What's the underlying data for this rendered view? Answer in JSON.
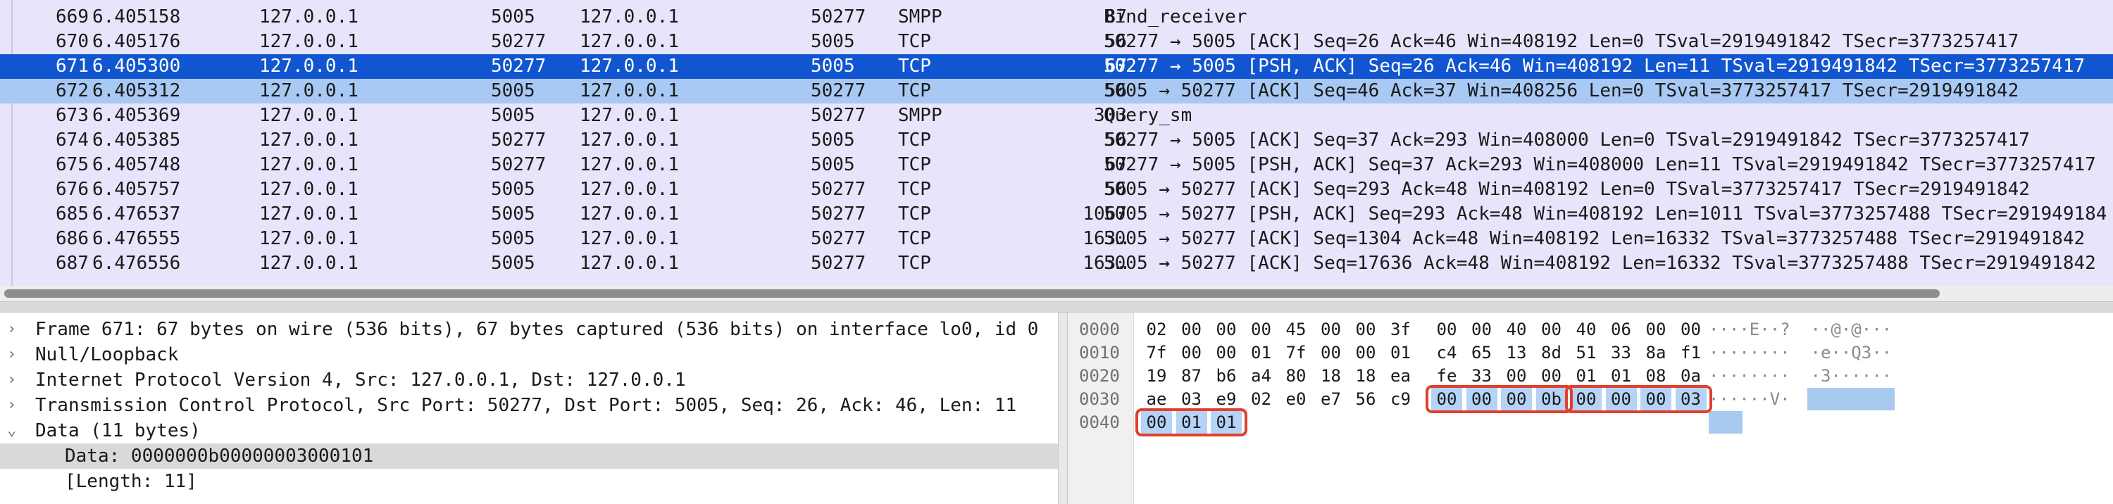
{
  "packet_list": {
    "rows": [
      {
        "no": "669",
        "time": "6.405158",
        "src": "127.0.0.1",
        "sport": "5005",
        "dst": "127.0.0.1",
        "dport": "50277",
        "proto": "SMPP",
        "len": "87",
        "info": "Bind_receiver",
        "state": "normal"
      },
      {
        "no": "670",
        "time": "6.405176",
        "src": "127.0.0.1",
        "sport": "50277",
        "dst": "127.0.0.1",
        "dport": "5005",
        "proto": "TCP",
        "len": "56",
        "info": "50277 → 5005 [ACK] Seq=26 Ack=46 Win=408192 Len=0 TSval=2919491842 TSecr=3773257417",
        "state": "normal"
      },
      {
        "no": "671",
        "time": "6.405300",
        "src": "127.0.0.1",
        "sport": "50277",
        "dst": "127.0.0.1",
        "dport": "5005",
        "proto": "TCP",
        "len": "67",
        "info": "50277 → 5005 [PSH, ACK] Seq=26 Ack=46 Win=408192 Len=11 TSval=2919491842 TSecr=3773257417",
        "state": "selected"
      },
      {
        "no": "672",
        "time": "6.405312",
        "src": "127.0.0.1",
        "sport": "5005",
        "dst": "127.0.0.1",
        "dport": "50277",
        "proto": "TCP",
        "len": "56",
        "info": "5005 → 50277 [ACK] Seq=46 Ack=37 Win=408256 Len=0 TSval=3773257417 TSecr=2919491842",
        "state": "related"
      },
      {
        "no": "673",
        "time": "6.405369",
        "src": "127.0.0.1",
        "sport": "5005",
        "dst": "127.0.0.1",
        "dport": "50277",
        "proto": "SMPP",
        "len": "303",
        "info": "Query_sm",
        "state": "normal"
      },
      {
        "no": "674",
        "time": "6.405385",
        "src": "127.0.0.1",
        "sport": "50277",
        "dst": "127.0.0.1",
        "dport": "5005",
        "proto": "TCP",
        "len": "56",
        "info": "50277 → 5005 [ACK] Seq=37 Ack=293 Win=408000 Len=0 TSval=2919491842 TSecr=3773257417",
        "state": "normal"
      },
      {
        "no": "675",
        "time": "6.405748",
        "src": "127.0.0.1",
        "sport": "50277",
        "dst": "127.0.0.1",
        "dport": "5005",
        "proto": "TCP",
        "len": "67",
        "info": "50277 → 5005 [PSH, ACK] Seq=37 Ack=293 Win=408000 Len=11 TSval=2919491842 TSecr=3773257417",
        "state": "normal"
      },
      {
        "no": "676",
        "time": "6.405757",
        "src": "127.0.0.1",
        "sport": "5005",
        "dst": "127.0.0.1",
        "dport": "50277",
        "proto": "TCP",
        "len": "56",
        "info": "5005 → 50277 [ACK] Seq=293 Ack=48 Win=408192 Len=0 TSval=3773257417 TSecr=2919491842",
        "state": "normal"
      },
      {
        "no": "685",
        "time": "6.476537",
        "src": "127.0.0.1",
        "sport": "5005",
        "dst": "127.0.0.1",
        "dport": "50277",
        "proto": "TCP",
        "len": "1067",
        "info": "5005 → 50277 [PSH, ACK] Seq=293 Ack=48 Win=408192 Len=1011 TSval=3773257488 TSecr=291949184",
        "state": "normal"
      },
      {
        "no": "686",
        "time": "6.476555",
        "src": "127.0.0.1",
        "sport": "5005",
        "dst": "127.0.0.1",
        "dport": "50277",
        "proto": "TCP",
        "len": "163…",
        "info": "5005 → 50277 [ACK] Seq=1304 Ack=48 Win=408192 Len=16332 TSval=3773257488 TSecr=2919491842",
        "state": "normal"
      },
      {
        "no": "687",
        "time": "6.476556",
        "src": "127.0.0.1",
        "sport": "5005",
        "dst": "127.0.0.1",
        "dport": "50277",
        "proto": "TCP",
        "len": "163…",
        "info": "5005 → 50277 [ACK] Seq=17636 Ack=48 Win=408192 Len=16332 TSval=3773257488 TSecr=2919491842",
        "state": "normal"
      }
    ]
  },
  "details": {
    "rows": [
      {
        "arrow": "›",
        "text": "Frame 671: 67 bytes on wire (536 bits), 67 bytes captured (536 bits) on interface lo0, id 0"
      },
      {
        "arrow": "›",
        "text": "Null/Loopback"
      },
      {
        "arrow": "›",
        "text": "Internet Protocol Version 4, Src: 127.0.0.1, Dst: 127.0.0.1"
      },
      {
        "arrow": "›",
        "text": "Transmission Control Protocol, Src Port: 50277, Dst Port: 5005, Seq: 26, Ack: 46, Len: 11"
      },
      {
        "arrow": "⌄",
        "text": "Data (11 bytes)"
      },
      {
        "arrow": "",
        "text": "Data: 0000000b00000003000101"
      },
      {
        "arrow": "",
        "text": "[Length: 11]"
      }
    ]
  },
  "bytes": {
    "offsets": [
      "0000",
      "0010",
      "0020",
      "0030",
      "0040"
    ],
    "rows": [
      [
        "02",
        "00",
        "00",
        "00",
        "45",
        "00",
        "00",
        "3f",
        "00",
        "00",
        "40",
        "00",
        "40",
        "06",
        "00",
        "00"
      ],
      [
        "7f",
        "00",
        "00",
        "01",
        "7f",
        "00",
        "00",
        "01",
        "c4",
        "65",
        "13",
        "8d",
        "51",
        "33",
        "8a",
        "f1"
      ],
      [
        "19",
        "87",
        "b6",
        "a4",
        "80",
        "18",
        "18",
        "ea",
        "fe",
        "33",
        "00",
        "00",
        "01",
        "01",
        "08",
        "0a"
      ],
      [
        "ae",
        "03",
        "e9",
        "02",
        "e0",
        "e7",
        "56",
        "c9",
        "00",
        "00",
        "00",
        "0b",
        "00",
        "00",
        "00",
        "03"
      ],
      [
        "00",
        "01",
        "01"
      ]
    ],
    "ascii": [
      "····E··?  ··@·@···",
      "········  ·e··Q3··",
      "········  ·3······",
      "······V·  ········",
      "···"
    ]
  },
  "colors": {
    "selected": "#1155d0",
    "related": "#a9c9f5",
    "highlight": "#b5d3f7",
    "callout": "#e0402e"
  }
}
